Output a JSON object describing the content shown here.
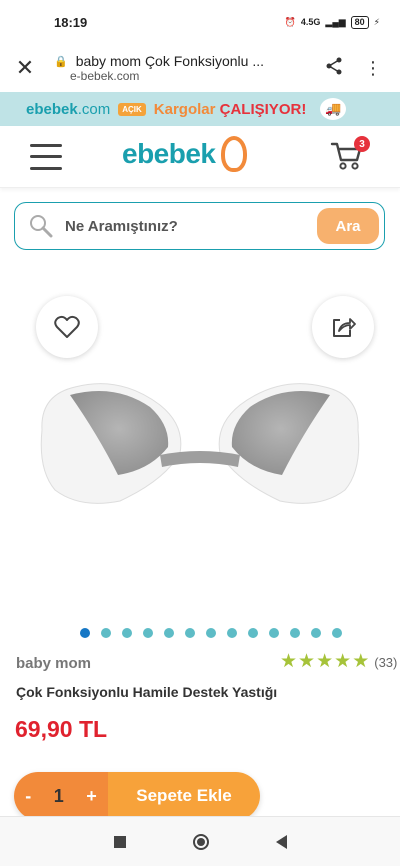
{
  "status_bar": {
    "time": "18:19",
    "network": "4.5G",
    "battery": "80"
  },
  "browser": {
    "title": "baby mom Çok Fonksiyonlu ...",
    "domain": "e-bebek.com",
    "close_icon": "close-icon",
    "share_icon": "share-icon",
    "menu_icon": "more-vert-icon"
  },
  "promo": {
    "logo_text": "ebebek",
    "logo_suffix": ".com",
    "badge": "AÇIK",
    "text": "Kargolar",
    "highlight": "ÇALIŞIYOR!"
  },
  "header": {
    "logo_text": "ebebek",
    "cart_count": "3"
  },
  "search": {
    "placeholder": "Ne Aramıştınız?",
    "button_label": "Ara"
  },
  "product": {
    "brand": "baby mom",
    "rating_count": "(33)",
    "rating_value": 5,
    "name": "Çok Fonksiyonlu Hamile Destek Yastığı",
    "price": "69,90 TL",
    "image_count": 13,
    "active_image": 0
  },
  "cart_bar": {
    "minus": "-",
    "quantity": "1",
    "plus": "+",
    "add_label": "Sepete Ekle"
  },
  "colors": {
    "brand_teal": "#1a9fae",
    "brand_orange": "#f28a3a",
    "price_red": "#e0222e",
    "star_green": "#a6c33a"
  }
}
